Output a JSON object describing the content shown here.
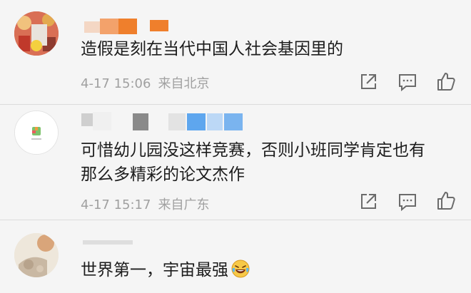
{
  "comments": [
    {
      "text": "造假是刻在当代中国人社会基因里的",
      "date": "4-17 15:06",
      "location": "来自北京"
    },
    {
      "text_line1": "可惜幼儿园没这样竞赛，否则小班同学肯定也有",
      "text_line2": "那么多精彩的论文杰作",
      "date": "4-17 15:17",
      "location": "来自广东"
    },
    {
      "text": "世界第一，宇宙最强"
    }
  ],
  "actions": [
    "share-icon",
    "comment-icon",
    "like-icon"
  ],
  "colors": {
    "background": "#f5f5f5",
    "text": "#1d1d1d",
    "meta": "#a0a0a0",
    "name_orange": "#ef7f2c",
    "name_blue": "#5ea6ee"
  }
}
